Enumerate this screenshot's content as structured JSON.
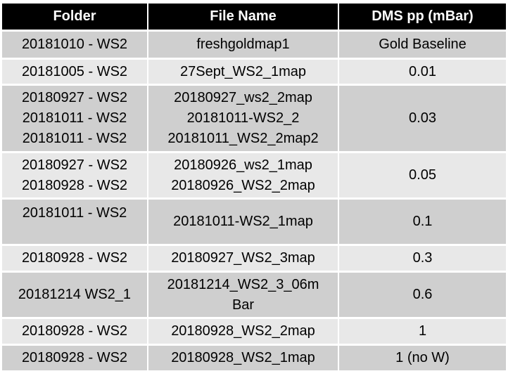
{
  "table": {
    "headers": [
      "Folder",
      "File Name",
      "DMS pp (mBar)"
    ],
    "rows": [
      {
        "folders": [
          "20181010 - WS2"
        ],
        "files": [
          "freshgoldmap1"
        ],
        "dms": "Gold Baseline",
        "shade": "dark"
      },
      {
        "folders": [
          "20181005 - WS2"
        ],
        "files": [
          "27Sept_WS2_1map"
        ],
        "dms": "0.01",
        "shade": "light"
      },
      {
        "folders": [
          "20180927 - WS2",
          "20181011 - WS2",
          "20181011 - WS2"
        ],
        "files": [
          "20180927_ws2_2map",
          "20181011-WS2_2",
          "20181011_WS2_2map2"
        ],
        "dms": "0.03",
        "shade": "dark"
      },
      {
        "folders": [
          "20180927 - WS2",
          "20180928 - WS2"
        ],
        "files": [
          "20180926_ws2_1map",
          "20180926_WS2_2map"
        ],
        "dms": "0.05",
        "shade": "light"
      },
      {
        "folders": [
          "20181011 - WS2"
        ],
        "files": [
          "20181011-WS2_1map"
        ],
        "dms": "0.1",
        "shade": "dark"
      },
      {
        "folders": [
          "20180928 - WS2"
        ],
        "files": [
          "20180927_WS2_3map"
        ],
        "dms": "0.3",
        "shade": "light"
      },
      {
        "folders": [
          "20181214 WS2_1"
        ],
        "files": [
          "20181214_WS2_3_06m",
          "Bar"
        ],
        "dms": "0.6",
        "shade": "dark"
      },
      {
        "folders": [
          "20180928 - WS2"
        ],
        "files": [
          "20180928_WS2_2map"
        ],
        "dms": "1",
        "shade": "light"
      },
      {
        "folders": [
          "20180928 - WS2"
        ],
        "files": [
          "20180928_WS2_1map"
        ],
        "dms": "1 (no W)",
        "shade": "dark"
      }
    ]
  },
  "colors": {
    "header_bg": "#000000",
    "header_text": "#ffffff",
    "row_dark": "#cfcfcf",
    "row_light": "#e8e8e8"
  }
}
